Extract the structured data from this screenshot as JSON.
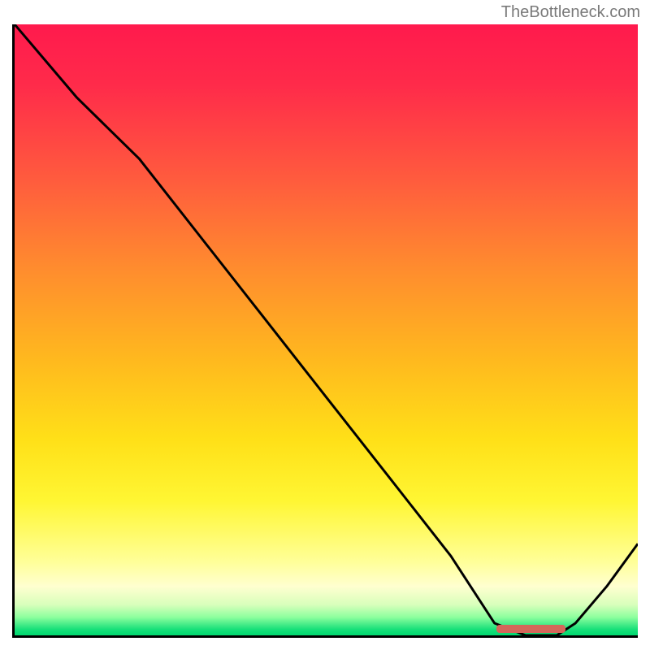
{
  "attribution": "TheBottleneck.com",
  "chart_data": {
    "type": "line",
    "title": "",
    "xlabel": "",
    "ylabel": "",
    "x": [
      0,
      5,
      10,
      20,
      30,
      40,
      50,
      60,
      70,
      77,
      82,
      87,
      90,
      95,
      100
    ],
    "values": [
      100,
      94,
      88,
      78,
      65,
      52,
      39,
      26,
      13,
      2,
      0,
      0,
      2,
      8,
      15
    ],
    "ylim": [
      0,
      100
    ],
    "xlim": [
      0,
      100
    ],
    "flat_region_x": [
      77,
      88
    ],
    "annotations": [],
    "legend": []
  },
  "colors": {
    "curve": "#000000",
    "flat_marker": "#d4665a",
    "axis": "#000000"
  }
}
